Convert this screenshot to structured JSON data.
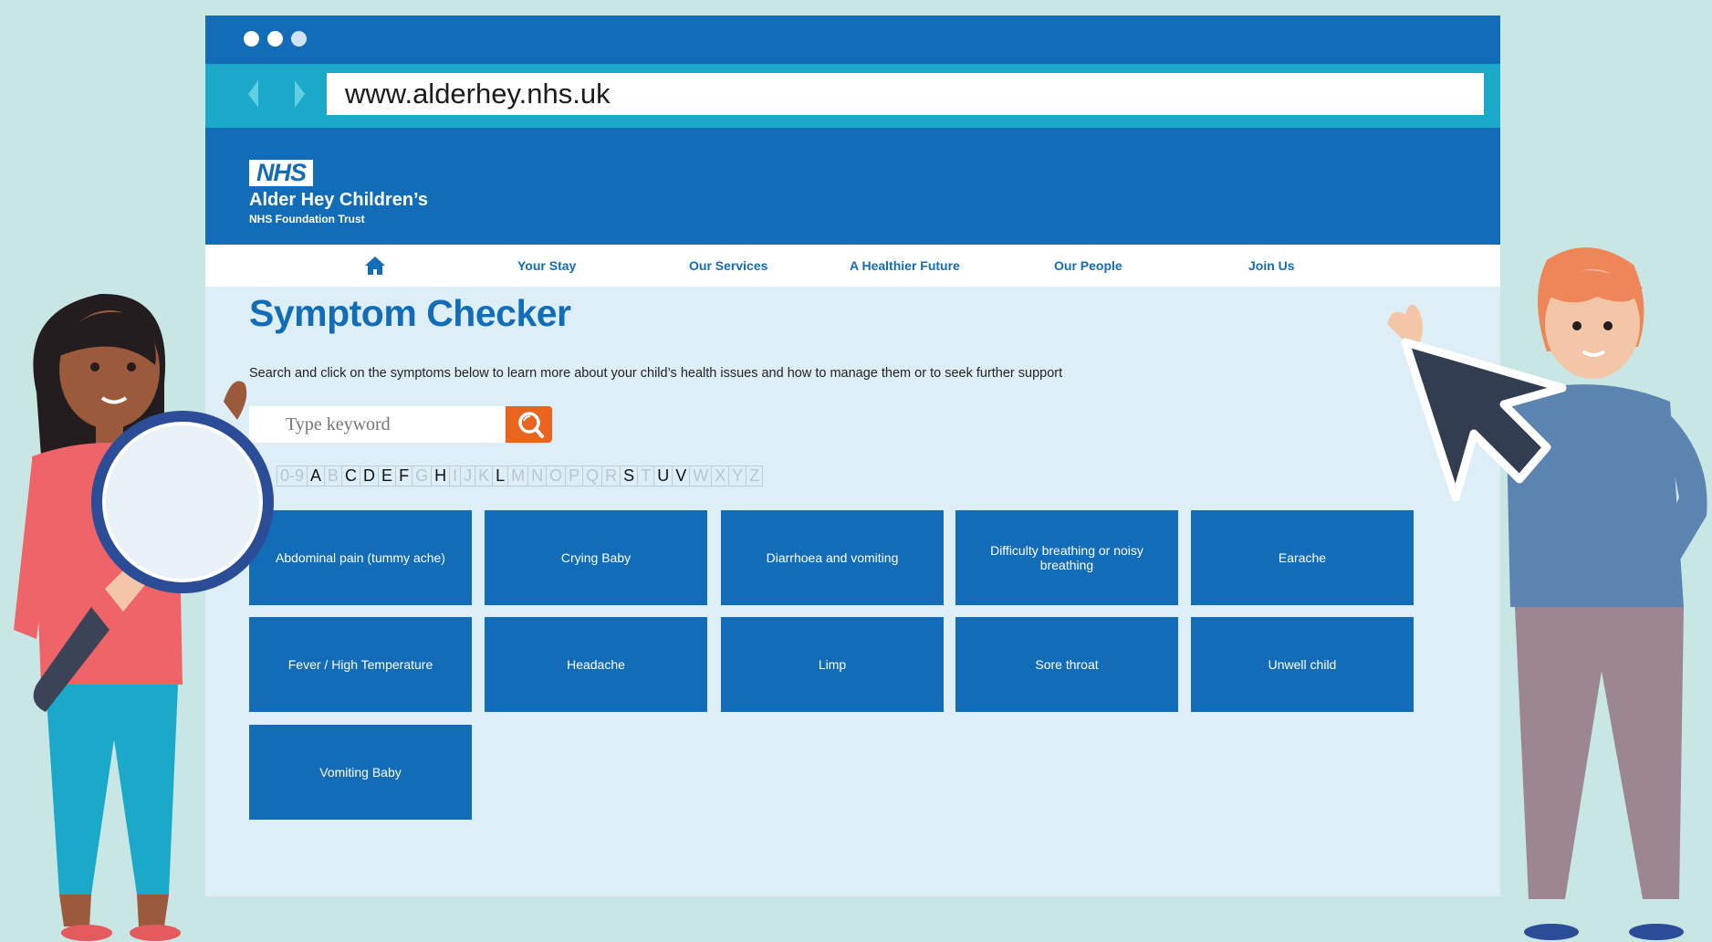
{
  "browser": {
    "url": "www.alderhey.nhs.uk"
  },
  "header": {
    "logo_text": "NHS",
    "org_name": "Alder Hey Children’s",
    "org_subtitle": "NHS Foundation Trust"
  },
  "nav": {
    "home_icon": "home-icon",
    "items": [
      {
        "label": "Your Stay"
      },
      {
        "label": "Our Services"
      },
      {
        "label": "A Healthier Future"
      },
      {
        "label": "Our People"
      },
      {
        "label": "Join Us"
      }
    ]
  },
  "main": {
    "title": "Symptom Checker",
    "intro": "Search and click on the symptoms below to learn more about your child’s health issues and how to manage them or to seek further support",
    "search": {
      "placeholder": "Type keyword",
      "button_icon": "search-icon"
    },
    "az_filter": [
      {
        "label": "0-9",
        "active": false
      },
      {
        "label": "A",
        "active": true
      },
      {
        "label": "B",
        "active": false
      },
      {
        "label": "C",
        "active": true
      },
      {
        "label": "D",
        "active": true
      },
      {
        "label": "E",
        "active": true
      },
      {
        "label": "F",
        "active": true
      },
      {
        "label": "G",
        "active": false
      },
      {
        "label": "H",
        "active": true
      },
      {
        "label": "I",
        "active": false
      },
      {
        "label": "J",
        "active": false
      },
      {
        "label": "K",
        "active": false
      },
      {
        "label": "L",
        "active": true
      },
      {
        "label": "M",
        "active": false
      },
      {
        "label": "N",
        "active": false
      },
      {
        "label": "O",
        "active": false
      },
      {
        "label": "P",
        "active": false
      },
      {
        "label": "Q",
        "active": false
      },
      {
        "label": "R",
        "active": false
      },
      {
        "label": "S",
        "active": true
      },
      {
        "label": "T",
        "active": false
      },
      {
        "label": "U",
        "active": true
      },
      {
        "label": "V",
        "active": true
      },
      {
        "label": "W",
        "active": false
      },
      {
        "label": "X",
        "active": false
      },
      {
        "label": "Y",
        "active": false
      },
      {
        "label": "Z",
        "active": false
      }
    ],
    "symptoms": [
      {
        "label": "Abdominal pain (tummy ache)"
      },
      {
        "label": "Crying Baby"
      },
      {
        "label": "Diarrhoea and vomiting"
      },
      {
        "label": "Difficulty breathing or noisy breathing"
      },
      {
        "label": "Earache"
      },
      {
        "label": "Fever / High Temperature"
      },
      {
        "label": "Headache"
      },
      {
        "label": "Limp"
      },
      {
        "label": "Sore throat"
      },
      {
        "label": "Unwell child"
      },
      {
        "label": "Vomiting Baby"
      }
    ]
  },
  "colors": {
    "nhs_blue": "#126cb8",
    "teal": "#1ba9c9",
    "search_orange": "#e8641f",
    "background": "#c8e6e4"
  }
}
